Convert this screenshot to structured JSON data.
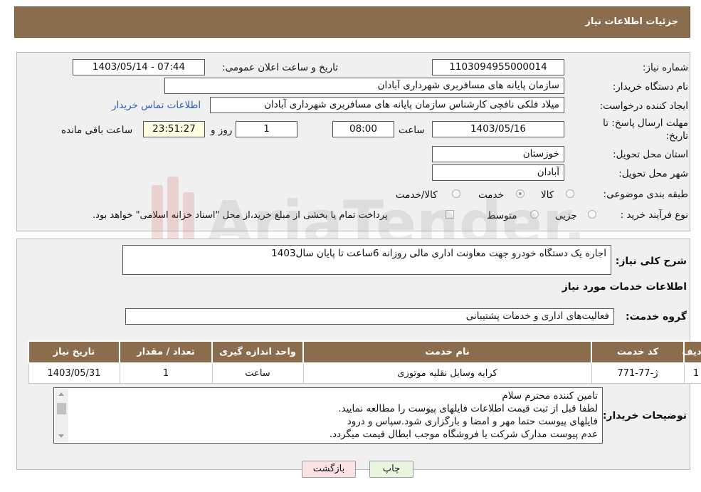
{
  "header": {
    "title": "جزئیات اطلاعات نیاز"
  },
  "form": {
    "need_number_label": "شماره نیاز:",
    "need_number": "1103094955000014",
    "announce_label": "تاریخ و ساعت اعلان عمومی:",
    "announce_value": "1403/05/14 - 07:44",
    "buyer_org_label": "نام دستگاه خریدار:",
    "buyer_org": "سازمان پایانه های مسافربری شهرداری آبادان",
    "creator_label": "ایجاد کننده درخواست:",
    "creator": "میلاد فلکی نافچی کارشناس سازمان پایانه های مسافربری شهرداری آبادان",
    "contact_link": "اطلاعات تماس خریدار",
    "deadline_label_1": "مهلت ارسال پاسخ: تا",
    "deadline_label_2": "تاریخ:",
    "deadline_date": "1403/05/16",
    "time_label": "ساعت",
    "deadline_time": "08:00",
    "days_value": "1",
    "days_label": "روز و",
    "remaining_time": "23:51:27",
    "remaining_label": "ساعت باقی مانده",
    "province_label": "استان محل تحویل:",
    "province": "خوزستان",
    "city_label": "شهر محل تحویل:",
    "city": "آبادان",
    "category_label": "طبقه بندی موضوعی:",
    "category_options": [
      "کالا",
      "خدمت",
      "کالا/خدمت"
    ],
    "category_selected": "خدمت",
    "purchase_type_label": "نوع فرآیند خرید :",
    "purchase_options": [
      "جزیی",
      "متوسط"
    ],
    "payment_note": "پرداخت تمام یا بخشی از مبلغ خرید،از محل \"اسناد خزانه اسلامی\" خواهد بود."
  },
  "description": {
    "label": "شرح کلی نیاز:",
    "text": "اجاره یک دستگاه خودرو جهت معاونت اداری مالی روزانه 6ساعت تا پایان سال1403"
  },
  "services": {
    "section_title": "اطلاعات خدمات مورد نیاز",
    "group_label": "گروه خدمت:",
    "group_value": "فعالیت‌های اداری و خدمات پشتیبانی",
    "columns": [
      "ردیف",
      "کد خدمت",
      "نام خدمت",
      "واحد اندازه گیری",
      "تعداد / مقدار",
      "تاریخ نیاز"
    ],
    "rows": [
      [
        "1",
        "ژ-77-771",
        "کرایه وسایل نقلیه موتوری",
        "ساعت",
        "1",
        "1403/05/31"
      ]
    ]
  },
  "buyer_notes": {
    "label": "توضیحات خریدار:",
    "lines": [
      "تامین کننده محترم سلام",
      "لطفا قبل از ثبت قیمت اطلاعات فایلهای پیوست را مطالعه نمایید.",
      "فایلهای پیوست حتما مهر و امضا و بارگزاری شود.سپاس و درود",
      "عدم پیوست مدارک شرکت یا فروشگاه موجب ابطال قیمت میگردد."
    ]
  },
  "buttons": {
    "print": "چاپ",
    "back": "بازگشت"
  },
  "watermark": {
    "text": "AriaTender.neT"
  },
  "colors": {
    "header_bg": "#8b6d4d",
    "link": "#2a5fb5",
    "back_button_bg": "#fbe3e3",
    "print_button_bg": "#e8f6e0"
  }
}
